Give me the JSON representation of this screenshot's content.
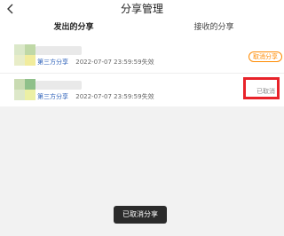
{
  "header": {
    "title": "分享管理",
    "back_icon": "chevron-left-icon"
  },
  "tabs": [
    {
      "label": "发出的分享",
      "active": true
    },
    {
      "label": "接收的分享",
      "active": false
    }
  ],
  "colors": {
    "accent": "#ff8a00",
    "highlight": "#e8232a",
    "tag": "#2b5fb8"
  },
  "shares": [
    {
      "tag": "第三方分享",
      "expires": "2022-07-07 23:59:59失效",
      "action": "取消分享"
    },
    {
      "tag": "第三方分享",
      "expires": "2022-07-07 23:59:59失效",
      "status": "已取消"
    }
  ],
  "toast": "已取消分享"
}
